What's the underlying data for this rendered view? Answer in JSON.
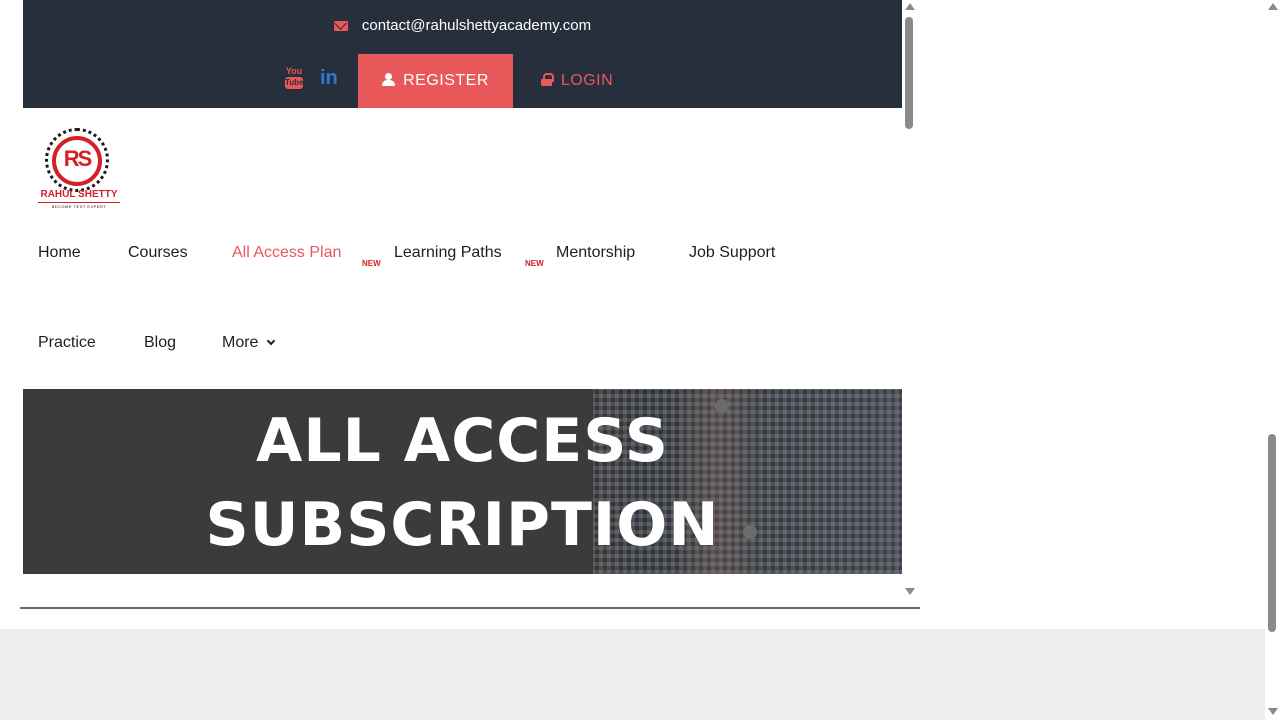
{
  "topbar": {
    "email": "contact@rahulshettyacademy.com",
    "register_label": "REGISTER",
    "login_label": "LOGIN",
    "social": {
      "youtube_top": "You",
      "youtube_bottom": "Tube",
      "linkedin": "in"
    }
  },
  "logo": {
    "mark": "RS",
    "name": "RAHUL SHETTY",
    "tagline": "BECOME TEST EXPERT"
  },
  "nav": {
    "row1": [
      {
        "label": "Home"
      },
      {
        "label": "Courses"
      },
      {
        "label": "All Access Plan",
        "badge": "NEW",
        "active": true
      },
      {
        "label": "Learning Paths",
        "badge": "NEW"
      },
      {
        "label": "Mentorship"
      },
      {
        "label": "Job Support"
      }
    ],
    "row2": [
      {
        "label": "Practice"
      },
      {
        "label": "Blog"
      },
      {
        "label": "More",
        "has_dropdown": true
      }
    ]
  },
  "hero": {
    "title_line1": "ALL ACCESS",
    "title_line2": "SUBSCRIPTION"
  },
  "colors": {
    "topbar_bg": "#282f3c",
    "accent": "#e8585b",
    "brand_red": "#d41f26",
    "linkedin_blue": "#2a7bd1"
  },
  "icons": {
    "email": "envelope-icon",
    "youtube": "youtube-icon",
    "linkedin": "linkedin-icon",
    "register": "user-icon",
    "login": "lock-icon",
    "more": "chevron-down-icon"
  }
}
